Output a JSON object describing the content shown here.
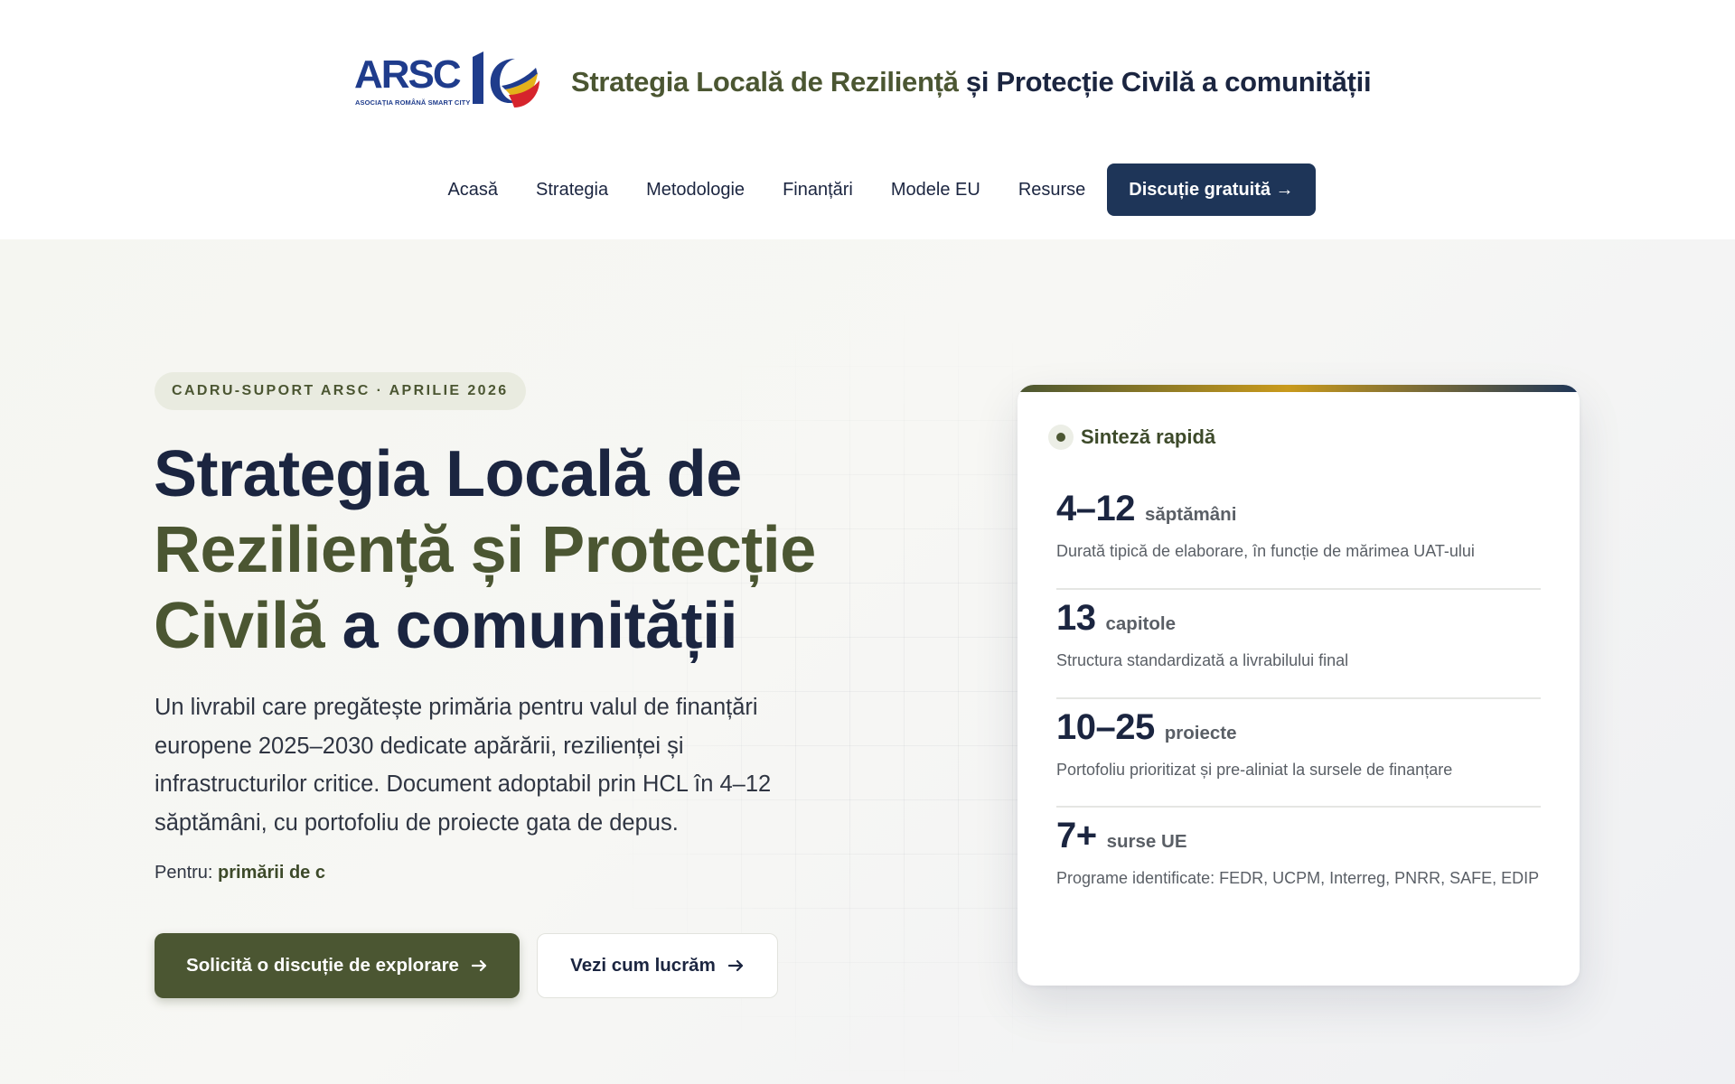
{
  "header": {
    "logo_text": "ARSC",
    "logo_subtitle": "ASOCIAȚIA ROMÂNĂ SMART CITY",
    "title_part1": "Strategia Locală de Reziliență",
    "title_part2": "și Protecție Civilă a comunității"
  },
  "nav": {
    "items": [
      {
        "label": "Acasă"
      },
      {
        "label": "Strategia"
      },
      {
        "label": "Metodologie"
      },
      {
        "label": "Finanțări"
      },
      {
        "label": "Modele EU"
      },
      {
        "label": "Resurse"
      }
    ],
    "cta_label": "Discuție gratuită →"
  },
  "hero": {
    "eyebrow": "CADRU-SUPORT ARSC · APRILIE 2026",
    "title_line1": "Strategia Locală de",
    "title_line2": "Reziliență și Protecție",
    "title_line3_part1": "Civilă",
    "title_line3_part2": "a comunității",
    "description": "Un livrabil care pregătește primăria pentru valul de finanțări europene 2025–2030 dedicate apărării, rezilienței și infrastructurilor critice. Document adoptabil prin HCL în 4–12 săptămâni, cu portofoliu de proiecte gata de depus.",
    "for_label": "Pentru:",
    "for_value": "primării de c",
    "primary_button": "Solicită o discuție de explorare",
    "secondary_button": "Vezi cum lucrăm"
  },
  "summary": {
    "heading": "Sinteză rapidă",
    "stats": [
      {
        "value": "4–12",
        "unit": "săptămâni",
        "description": "Durată tipică de elaborare, în funcție de mărimea UAT-ului"
      },
      {
        "value": "13",
        "unit": "capitole",
        "description": "Structura standardizată a livrabilului final"
      },
      {
        "value": "10–25",
        "unit": "proiecte",
        "description": "Portofoliu prioritizat și pre-aliniat la sursele de finanțare"
      },
      {
        "value": "7+",
        "unit": "surse UE",
        "description": "Programe identificate: FEDR, UCPM, Interreg, PNRR, SAFE, EDIP"
      }
    ]
  },
  "colors": {
    "navy": "#1b2540",
    "olive": "#4b5632",
    "cta_navy": "#1e3558",
    "gold": "#c99a1c"
  },
  "icons": [
    "arrow-right-icon",
    "status-dot-icon",
    "logo-10-emblem"
  ]
}
